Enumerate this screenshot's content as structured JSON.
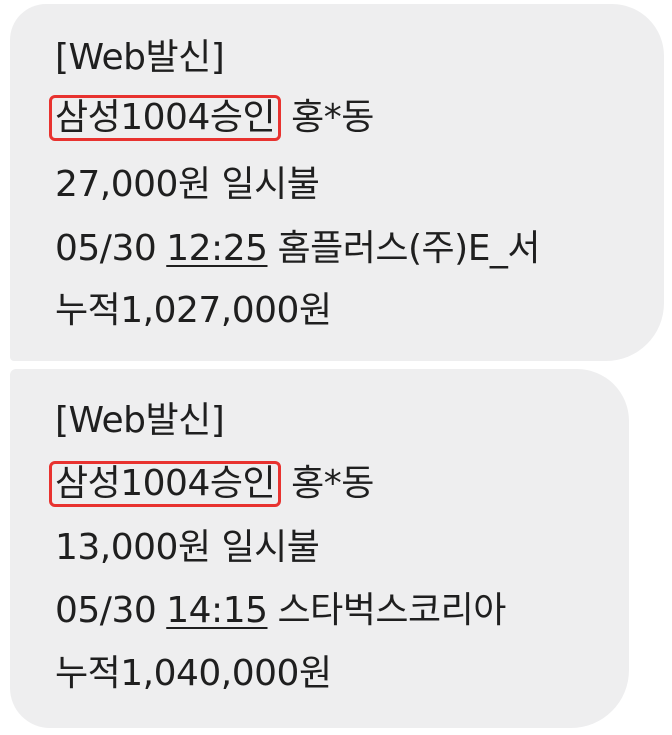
{
  "messages": [
    {
      "header": "[Web발신]",
      "approval": "삼성1004승인",
      "name": "홍*동",
      "amount_line": "27,000원 일시불",
      "date": "05/30",
      "time": "12:25",
      "merchant": "홈플러스(주)E_서",
      "cumulative": "누적1,027,000원"
    },
    {
      "header": "[Web발신]",
      "approval": "삼성1004승인",
      "name": "홍*동",
      "amount_line": "13,000원 일시불",
      "date": "05/30",
      "time": "14:15",
      "merchant": "스타벅스코리아",
      "cumulative": "누적1,040,000원"
    }
  ],
  "colors": {
    "bubble_background": "#eeeeef",
    "text": "#1f1f1f",
    "highlight_box": "#e8322f"
  }
}
